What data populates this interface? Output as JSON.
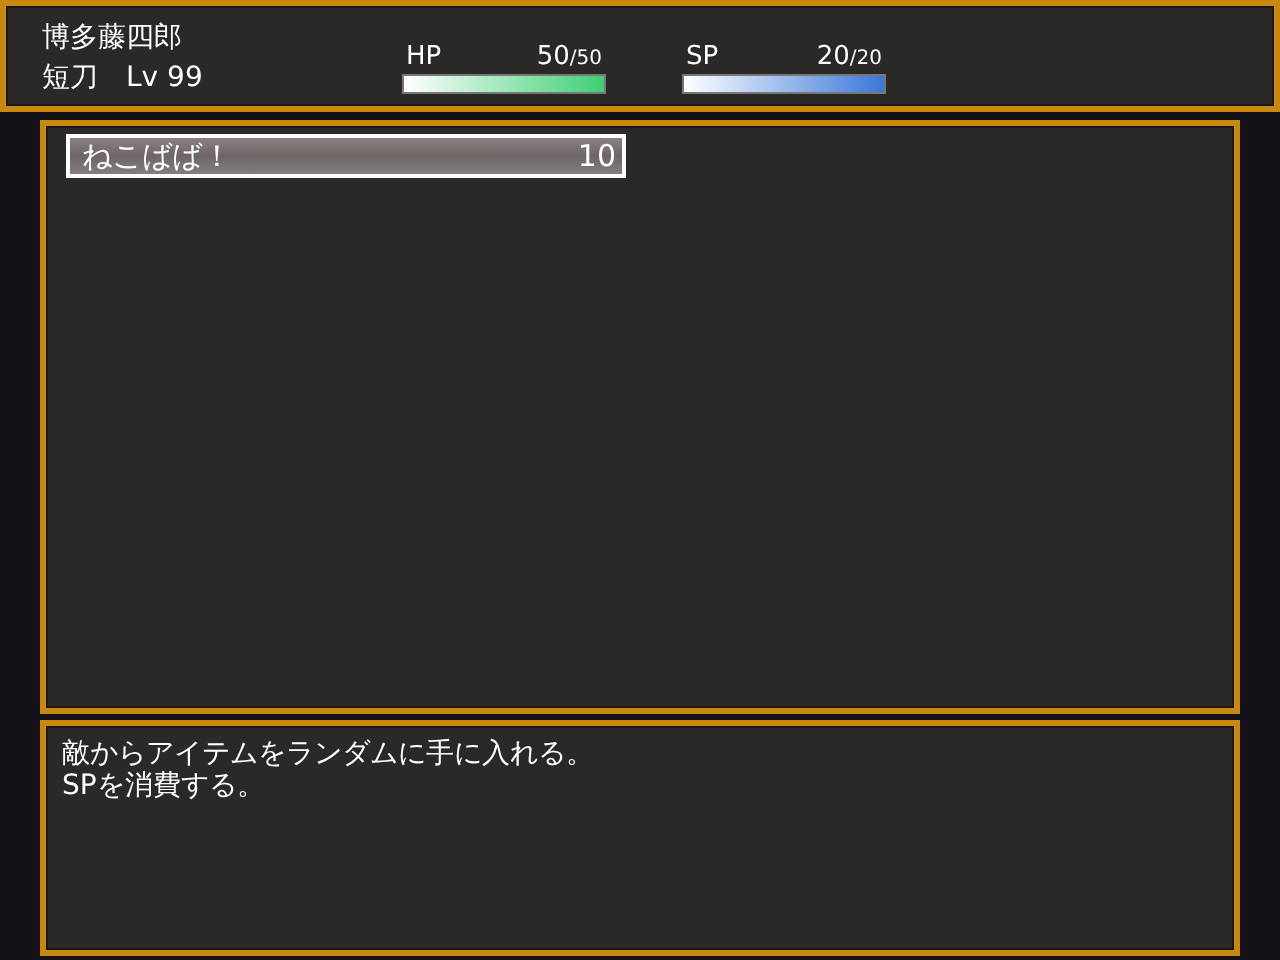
{
  "status": {
    "name": "博多藤四郎",
    "class": "短刀",
    "level_label": "Lv",
    "level": "99",
    "gauges": [
      {
        "label": "HP",
        "value": "50",
        "max": "/50",
        "level": 1,
        "kind": "hp"
      },
      {
        "label": "SP",
        "value": "20",
        "max": "/20",
        "level": 1,
        "kind": "sp"
      }
    ]
  },
  "skills": [
    {
      "name": "ねこばば！",
      "cost": "10",
      "selected": true
    }
  ],
  "help": {
    "lines": [
      "敵からアイテムをランダムに手に入れる。",
      "SPを消費する。"
    ]
  }
}
